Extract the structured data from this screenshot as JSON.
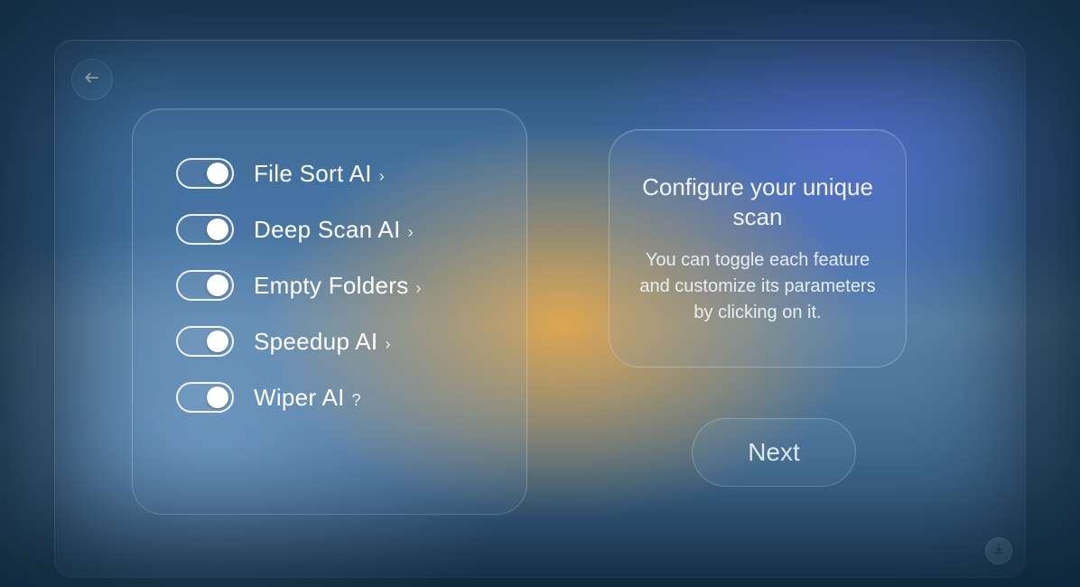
{
  "features": [
    {
      "label": "File Sort AI",
      "suffix": "›",
      "on": true
    },
    {
      "label": "Deep Scan AI",
      "suffix": "›",
      "on": true
    },
    {
      "label": "Empty Folders",
      "suffix": "›",
      "on": true
    },
    {
      "label": "Speedup AI",
      "suffix": "›",
      "on": true
    },
    {
      "label": "Wiper AI",
      "suffix": "?",
      "on": true
    }
  ],
  "info": {
    "title": "Configure your unique scan",
    "body": "You can toggle each feature and customize its parameters by clicking on it."
  },
  "next_label": "Next"
}
